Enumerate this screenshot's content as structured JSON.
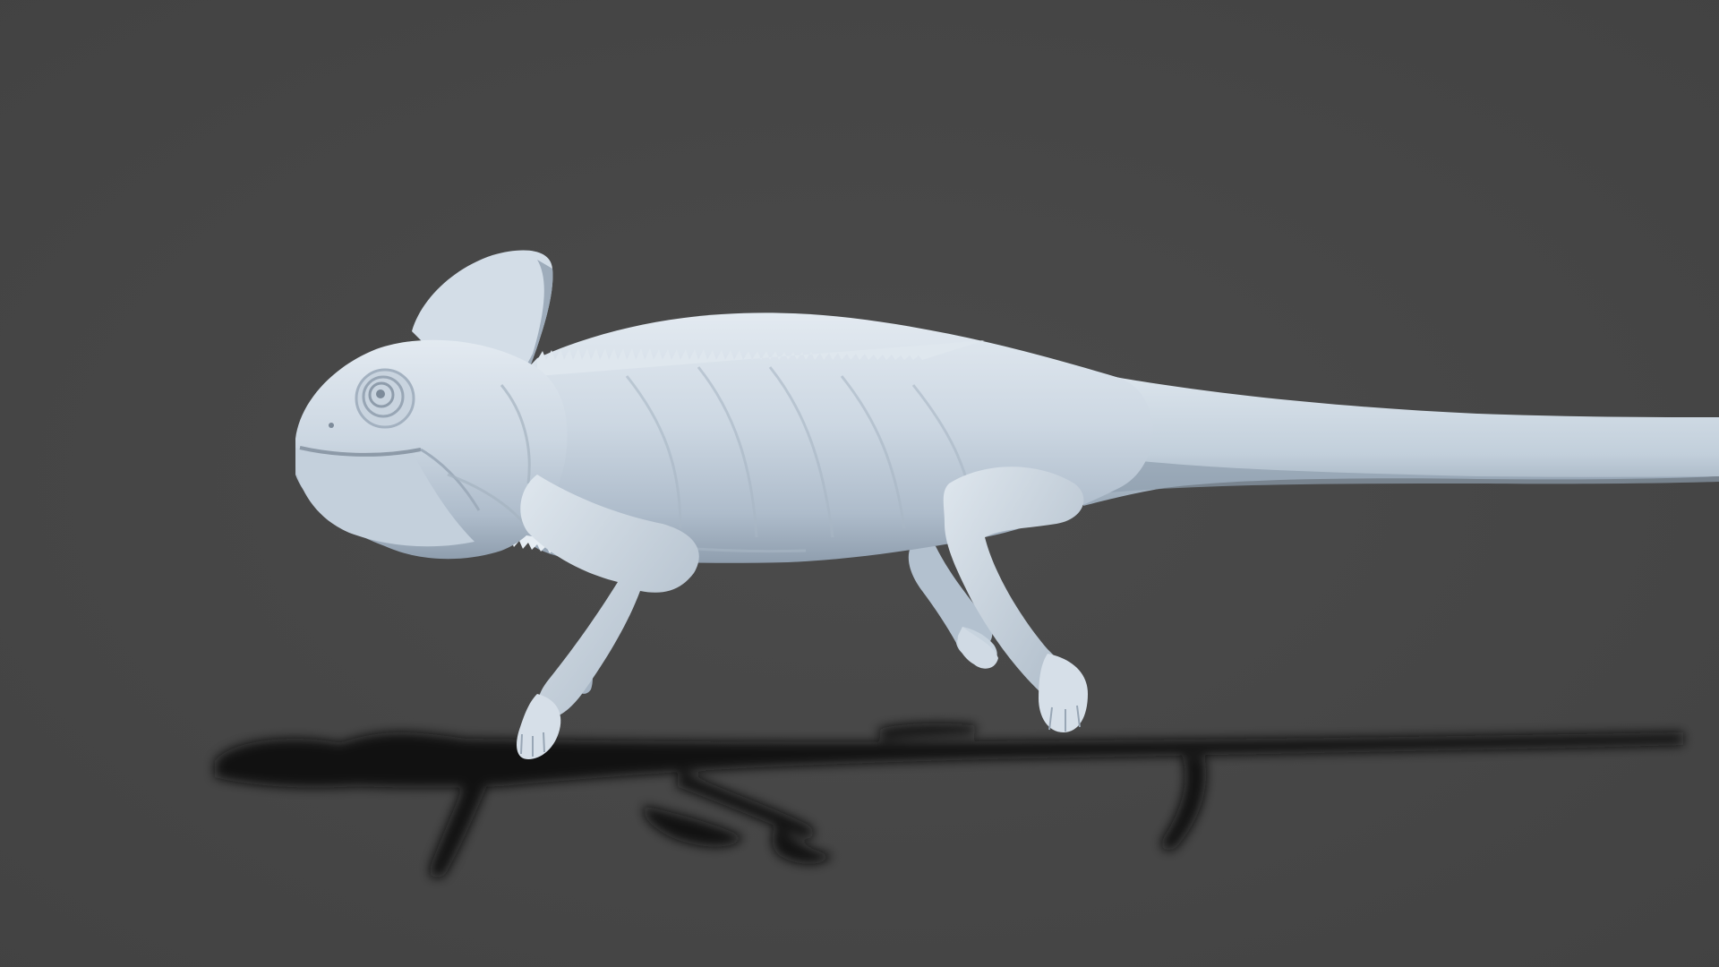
{
  "scene": {
    "subject": "chameleon-sculpt",
    "colors": {
      "background": "#474747",
      "background_center": "#4d4d4d",
      "model_light": "#dfe7ee",
      "model_mid": "#bcc9d6",
      "model_shadow": "#8d9aa8",
      "cast_shadow": "#0f0f0f"
    }
  }
}
